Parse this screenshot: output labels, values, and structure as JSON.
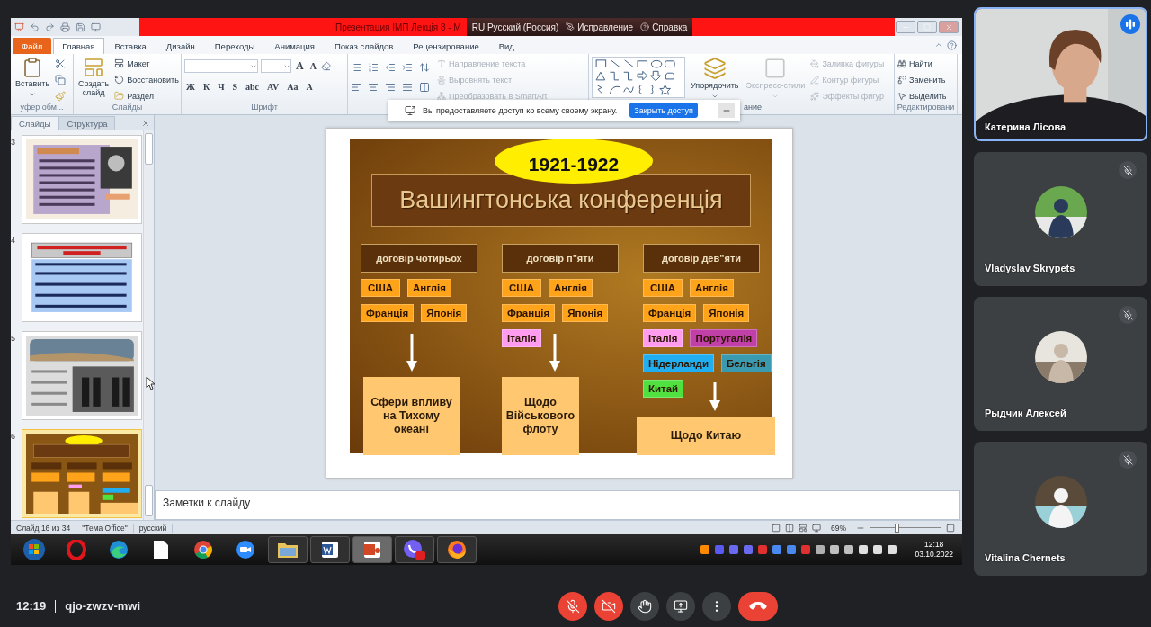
{
  "window": {
    "title": "Презентация ІМП Лекція 8  -  M"
  },
  "language_bar": {
    "language": "RU Русский (Россия)",
    "correction": "Исправление",
    "help": "Справка"
  },
  "ribbon_tabs": [
    {
      "label": "Файл",
      "kind": "file",
      "selected": false
    },
    {
      "label": "Главная",
      "kind": "tab",
      "selected": true
    },
    {
      "label": "Вставка",
      "kind": "tab",
      "selected": false
    },
    {
      "label": "Дизайн",
      "kind": "tab",
      "selected": false
    },
    {
      "label": "Переходы",
      "kind": "tab",
      "selected": false
    },
    {
      "label": "Анимация",
      "kind": "tab",
      "selected": false
    },
    {
      "label": "Показ слайдов",
      "kind": "tab",
      "selected": false
    },
    {
      "label": "Рецензирование",
      "kind": "tab",
      "selected": false
    },
    {
      "label": "Вид",
      "kind": "tab",
      "selected": false
    }
  ],
  "ribbon": {
    "clipboard": {
      "paste": "Вставить",
      "label": "уфер обм..."
    },
    "slides": {
      "new_slide": "Создать слайд",
      "layout": "Макет",
      "reset": "Восстановить",
      "section": "Раздел",
      "label": "Слайды"
    },
    "font": {
      "size_buttons": [
        "A",
        "A"
      ],
      "format_buttons": [
        "Ж",
        "К",
        "Ч",
        "S",
        "abc",
        "AV",
        "Aa",
        "A"
      ],
      "label": "Шрифт"
    },
    "paragraph": {
      "items": [
        {
          "label": "Направление текста",
          "disabled": true
        },
        {
          "label": "Выровнять текст",
          "disabled": true
        },
        {
          "label": "Преобразовать в SmartArt",
          "disabled": true
        }
      ]
    },
    "drawing": {
      "arrange": "Упорядочить",
      "quick_styles": {
        "label": "Экспресс-стили",
        "disabled": true
      },
      "label": "ание",
      "items": [
        {
          "label": "Заливка фигуры",
          "disabled": true
        },
        {
          "label": "Контур фигуры",
          "disabled": true
        },
        {
          "label": "Эффекты фигур",
          "disabled": true
        }
      ]
    },
    "editing": {
      "label": "Редактировани",
      "items": [
        {
          "label": "Найти",
          "disabled": false
        },
        {
          "label": "Заменить",
          "disabled": false
        },
        {
          "label": "Выделить",
          "disabled": false
        }
      ]
    }
  },
  "share_banner": {
    "message": "Вы предоставляете доступ ко всему своему экрану.",
    "stop_button": "Закрыть доступ"
  },
  "slide_pane": {
    "tabs": [
      {
        "label": "Слайды",
        "selected": true
      },
      {
        "label": "Структура",
        "selected": false
      }
    ],
    "thumbnails": [
      {
        "number": "3",
        "kind": "portrait",
        "selected": false
      },
      {
        "number": "4",
        "kind": "list",
        "selected": false
      },
      {
        "number": "5",
        "kind": "group-photo",
        "selected": false
      },
      {
        "number": "6",
        "kind": "diagram",
        "selected": true
      }
    ]
  },
  "slide": {
    "year": "1921-1922",
    "title": "Вашингтонська конференція",
    "columns": [
      {
        "header": "договір чотирьох",
        "result": "Сфери впливу на Тихому океані",
        "countries": [
          {
            "name": "США",
            "color": "#ffa31a"
          },
          {
            "name": "Англія",
            "color": "#ffa31a"
          },
          {
            "name": "Франція",
            "color": "#ffa31a"
          },
          {
            "name": "Японія",
            "color": "#ffa31a"
          }
        ]
      },
      {
        "header": "договір п\"яти",
        "result": "Щодо Військового флоту",
        "countries": [
          {
            "name": "США",
            "color": "#ffa31a"
          },
          {
            "name": "Англія",
            "color": "#ffa31a"
          },
          {
            "name": "Франція",
            "color": "#ffa31a"
          },
          {
            "name": "Японія",
            "color": "#ffa31a"
          },
          {
            "name": "Італія",
            "color": "#ff9cf0"
          }
        ]
      },
      {
        "header": "договір дев\"яти",
        "result": "Щодо Китаю",
        "countries": [
          {
            "name": "США",
            "color": "#ffa31a"
          },
          {
            "name": "Англія",
            "color": "#ffa31a"
          },
          {
            "name": "Франція",
            "color": "#ffa31a"
          },
          {
            "name": "Японія",
            "color": "#ffa31a"
          },
          {
            "name": "Італія",
            "color": "#ff9cf0"
          },
          {
            "name": "Португалія",
            "color": "#c040a8"
          },
          {
            "name": "Нідерланди",
            "color": "#20aef0"
          },
          {
            "name": "Бельгія",
            "color": "#3a9ab0"
          },
          {
            "name": "Китай",
            "color": "#50e040"
          }
        ]
      }
    ]
  },
  "notes": {
    "placeholder": "Заметки к слайду"
  },
  "status_bar": {
    "slide": "Слайд 16 из 34",
    "theme": "\"Тема Office\"",
    "language": "русский",
    "zoom": "69%",
    "zoom_slider": {
      "level": 0.37
    }
  },
  "taskbar": {
    "apps": [
      {
        "kind": "start",
        "running": false,
        "selected": false
      },
      {
        "kind": "ring",
        "running": false,
        "selected": false
      },
      {
        "kind": "edge",
        "running": false,
        "selected": false
      },
      {
        "kind": "file",
        "running": false,
        "selected": false
      },
      {
        "kind": "chrome",
        "running": false,
        "selected": false
      },
      {
        "kind": "camera",
        "running": false,
        "selected": false
      },
      {
        "kind": "folder",
        "running": true,
        "selected": false
      },
      {
        "kind": "word",
        "running": true,
        "selected": false
      },
      {
        "kind": "slides",
        "running": true,
        "selected": true
      },
      {
        "kind": "phone",
        "running": true,
        "selected": false
      },
      {
        "kind": "fox",
        "running": true,
        "selected": false
      }
    ],
    "time": "12:18",
    "date": "03.10.2022"
  },
  "meeting": {
    "time": "12:19",
    "code": "qjo-zwzv-mwi",
    "controls": [
      {
        "kind": "mic",
        "on": false
      },
      {
        "kind": "camera",
        "on": false
      },
      {
        "kind": "hand"
      },
      {
        "kind": "present"
      },
      {
        "kind": "more"
      },
      {
        "kind": "leave"
      }
    ]
  },
  "participants": [
    {
      "name": "Катерина Лісова",
      "kind": "video",
      "muted": false,
      "speaking": true
    },
    {
      "name": "Vladyslav Skrypets",
      "kind": "avatar",
      "muted": true,
      "speaking": false
    },
    {
      "name": "Рыдчик Алексей",
      "kind": "avatar",
      "muted": true,
      "speaking": false
    },
    {
      "name": "Vitalina Chernets",
      "kind": "avatar",
      "muted": true,
      "speaking": false
    }
  ]
}
